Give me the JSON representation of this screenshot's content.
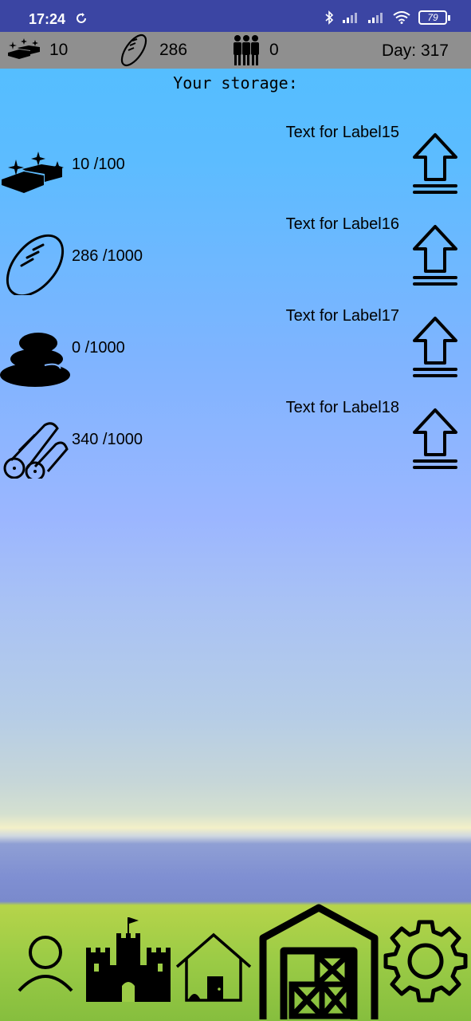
{
  "statusbar": {
    "time": "17:24",
    "battery": "79"
  },
  "topbar": {
    "gold": "10",
    "bread": "286",
    "people": "0",
    "day": "Day: 317"
  },
  "storage": {
    "title": "Your storage:",
    "rows": [
      {
        "icon": "gold-bars-icon",
        "value": "10 /100",
        "label": "Text for Label15"
      },
      {
        "icon": "bread-icon",
        "value": "286 /1000",
        "label": "Text for Label16"
      },
      {
        "icon": "stones-icon",
        "value": "0 /1000",
        "label": "Text for Label17"
      },
      {
        "icon": "logs-icon",
        "value": "340 /1000",
        "label": "Text for Label18"
      }
    ]
  },
  "bottomnav": [
    "person-icon",
    "castle-icon",
    "house-icon",
    "warehouse-icon",
    "gear-icon"
  ]
}
